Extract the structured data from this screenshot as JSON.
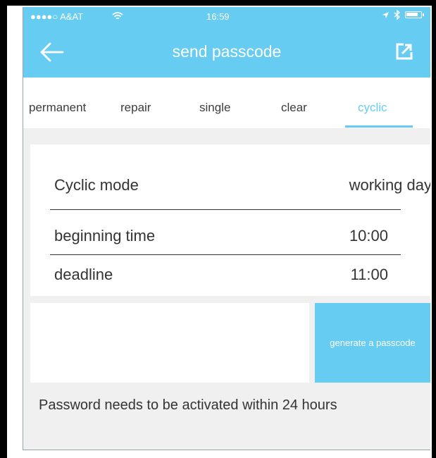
{
  "status_bar": {
    "carrier": "●●●●○  A&AT",
    "wifi_icon": "wifi-icon",
    "time": "16:59",
    "location_icon": "location-arrow-icon",
    "bluetooth_icon": "bluetooth-icon",
    "battery_icon": "battery-icon"
  },
  "header": {
    "title": "send passcode",
    "back_icon": "arrow-left-icon",
    "share_icon": "share-export-icon"
  },
  "tabs": [
    {
      "label": "permanent"
    },
    {
      "label": "repair"
    },
    {
      "label": "single"
    },
    {
      "label": "clear"
    },
    {
      "label": "cyclic"
    }
  ],
  "active_tab": "cyclic",
  "form": {
    "cyclic_mode": {
      "label": "Cyclic mode",
      "value": "working day"
    },
    "beginning_time": {
      "label": "beginning time",
      "value": "10:00"
    },
    "deadline": {
      "label": "deadline",
      "value": "11:00"
    }
  },
  "actions": {
    "generate_label": "generate a passcode"
  },
  "notice": "Password needs to be activated within 24 hours",
  "colors": {
    "accent": "#67ccf2",
    "background": "#f0f0f1",
    "text": "#333333"
  }
}
